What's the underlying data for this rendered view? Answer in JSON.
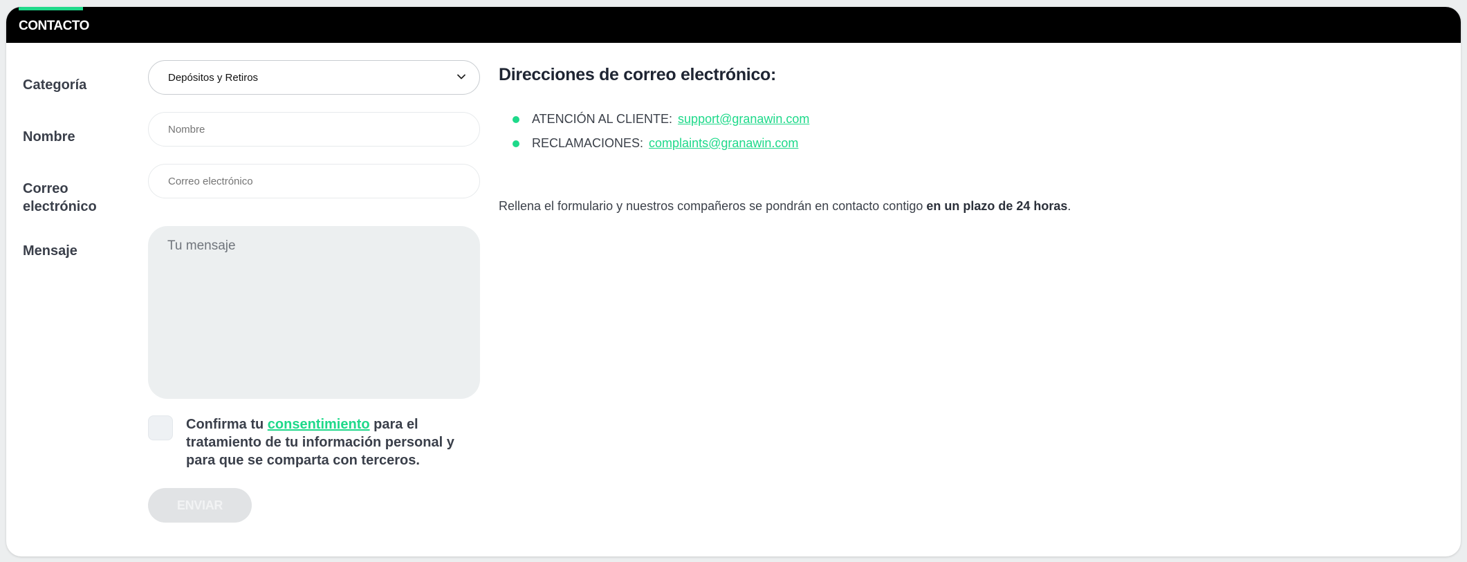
{
  "header": {
    "title": "CONTACTO"
  },
  "form": {
    "category_label": "Categoría",
    "category_value": "Depósitos y Retiros",
    "name_label": "Nombre",
    "name_placeholder": "Nombre",
    "email_label": "Correo electrónico",
    "email_placeholder": "Correo electrónico",
    "message_label": "Mensaje",
    "message_placeholder": "Tu mensaje",
    "consent_prefix": "Confirma tu ",
    "consent_link": "consentimiento",
    "consent_suffix": " para el tratamiento de tu información personal y para que se comparta con terceros.",
    "submit_label": "ENVIAR"
  },
  "contact": {
    "title": "Direcciones de correo electrónico:",
    "emails": [
      {
        "label": "ATENCIÓN AL CLIENTE:",
        "address": "support@granawin.com"
      },
      {
        "label": "RECLAMACIONES:",
        "address": "complaints@granawin.com"
      }
    ],
    "info_prefix": "Rellena el formulario y nuestros compañeros se pondrán en contacto contigo ",
    "info_bold": "en un plazo de 24 horas",
    "info_suffix": "."
  },
  "colors": {
    "accent": "#1ed98a",
    "header_bg": "#000000"
  },
  "icons": {
    "select_chevron": "chevron-down-icon"
  }
}
